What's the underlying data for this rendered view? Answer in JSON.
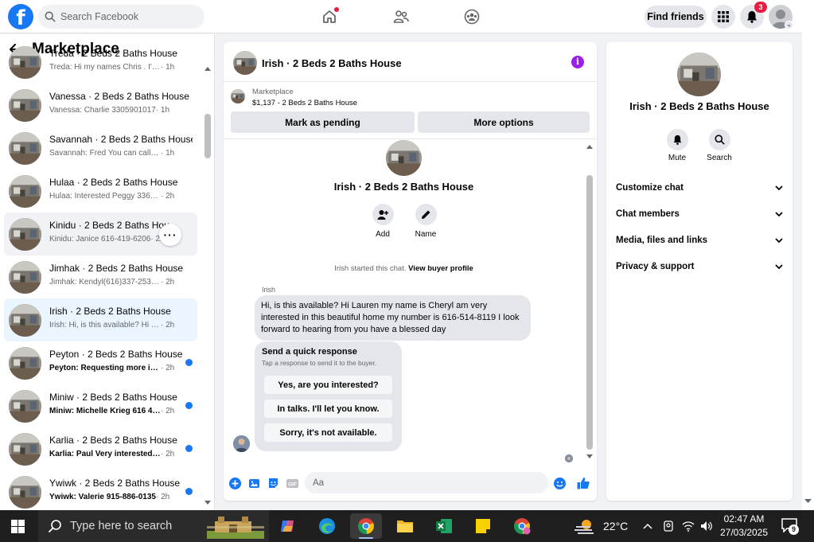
{
  "topbar": {
    "search_placeholder": "Search Facebook",
    "find_friends": "Find friends",
    "notification_count": "3"
  },
  "sidebar": {
    "title": "Marketplace",
    "conversations": [
      {
        "name": "Treda · 2 Beds 2 Baths House",
        "preview": "Treda: Hi my names Chris . I'm a pr...",
        "time": " · 1h",
        "unread": false
      },
      {
        "name": "Vanessa · 2 Beds 2 Baths House",
        "preview": "Vanessa: Charlie 3305901017",
        "time": " · 1h",
        "unread": false
      },
      {
        "name": "Savannah · 2 Beds 2 Baths House",
        "preview": "Savannah: Fred You can call or text...",
        "time": " · 1h",
        "unread": false
      },
      {
        "name": "Hulaa · 2 Beds 2 Baths House",
        "preview": "Hulaa: Interested Peggy 336-253-...",
        "time": " · 2h",
        "unread": false
      },
      {
        "name": "Kinidu · 2 Beds 2 Baths House",
        "preview": "Kinidu: Janice 616-419-6206",
        "time": " · 2h",
        "unread": false
      },
      {
        "name": "Jimhak · 2 Beds 2 Baths House",
        "preview": "Jimhak: Kendyl(616)337-2533 i wo...",
        "time": " · 2h",
        "unread": false
      },
      {
        "name": "Irish · 2 Beds 2 Baths House",
        "preview": "Irish: Hi, is this available? Hi Lauren...",
        "time": " · 2h",
        "unread": false
      },
      {
        "name": "Peyton · 2 Beds 2 Baths House",
        "preview": "Peyton: Requesting more infor...",
        "time": " · 2h",
        "unread": true
      },
      {
        "name": "Miniw · 2 Beds 2 Baths House",
        "preview": "Miniw: Michelle Krieg 616 427 ...",
        "time": " · 2h",
        "unread": true
      },
      {
        "name": "Karlia · 2 Beds 2 Baths House",
        "preview": "Karlia: Paul Very interested ple...",
        "time": " · 2h",
        "unread": true
      },
      {
        "name": "Ywiwk · 2 Beds 2 Baths House",
        "preview": "Ywiwk: Valerie 915-886-0135",
        "time": " · 2h",
        "unread": true
      }
    ]
  },
  "chat": {
    "title": "Irish · 2 Beds 2 Baths House",
    "listing_source": "Marketplace",
    "listing_price": "$1,137 - 2 Beds 2 Baths House",
    "mark_pending": "Mark as pending",
    "more_options": "More options",
    "actions": {
      "add": "Add",
      "name": "Name"
    },
    "started_text": "Irish started this chat. ",
    "view_buyer": "View buyer profile",
    "sender": "Irish",
    "message": "Hi, is this available? Hi Lauren my name is Cheryl am very interested in this beautiful home my number is 616-514-8119 I look forward to hearing from you have a blessed day",
    "quick_title": "Send a quick response",
    "quick_subtitle": "Tap a response to send it to the buyer.",
    "quick_responses": [
      "Yes, are you interested?",
      "In talks. I'll let you know.",
      "Sorry, it's not available."
    ],
    "input_placeholder": "Aa"
  },
  "details": {
    "title": "Irish · 2 Beds 2 Baths House",
    "mute": "Mute",
    "search": "Search",
    "sections": [
      "Customize chat",
      "Chat members",
      "Media, files and links",
      "Privacy & support"
    ]
  },
  "taskbar": {
    "search_placeholder": "Type here to search",
    "temperature": "22°C",
    "time": "02:47 AM",
    "date": "27/03/2025",
    "notification_count": "9"
  },
  "colors": {
    "brand": "#1877f2",
    "info": "#9b1fe8",
    "badge": "#e41e3f",
    "active_conversation": "#ebf5ff"
  }
}
